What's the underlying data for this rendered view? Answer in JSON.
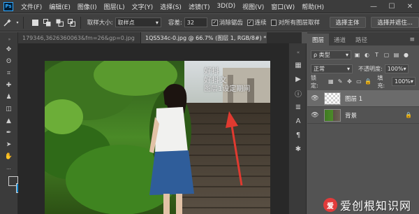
{
  "app": {
    "logo": "Ps"
  },
  "menu": [
    "文件(F)",
    "编辑(E)",
    "图像(I)",
    "图层(L)",
    "文字(Y)",
    "选择(S)",
    "滤镜(T)",
    "3D(D)",
    "视图(V)",
    "窗口(W)",
    "帮助(H)"
  ],
  "window_controls": {
    "minimize": "—",
    "maximize": "☐",
    "close": "✕"
  },
  "options_bar": {
    "sample_size_label": "取样大小:",
    "sample_size_value": "取样点",
    "tolerance_label": "容差:",
    "tolerance_value": "32",
    "antialias_label": "消除锯齿",
    "antialias_checked": true,
    "contiguous_label": "连续",
    "contiguous_checked": true,
    "all_layers_label": "对所有图层取样",
    "all_layers_checked": false,
    "select_subject_label": "选择主体",
    "select_and_mask_label": "选择并遮住..."
  },
  "doc_tabs": [
    {
      "label": "179346,3626360063&fm=26&gp=0.jpg",
      "active": false
    },
    {
      "label": "1QS534c-0.jpg @ 66.7% (图层 1, RGB/8#) *",
      "active": true
    }
  ],
  "panel_tabs": [
    "图层",
    "通道",
    "路径"
  ],
  "layers_panel": {
    "filter_label": "ρ 类型",
    "blend_mode": "正常",
    "opacity_label": "不透明度:",
    "opacity_value": "100%",
    "lock_label": "锁定:",
    "fill_label": "填充:",
    "fill_value": "100%",
    "layers": [
      {
        "name": "图层 1",
        "selected": true,
        "locked": false
      },
      {
        "name": "背景",
        "selected": false,
        "locked": true
      }
    ]
  },
  "canvas_overlay": {
    "lines": [
      "好抖",
      "好抖文",
      "图层1设定期间"
    ]
  },
  "watermark": {
    "logo_char": "爱",
    "text": "爱创根知识网"
  },
  "colors": {
    "accent": "#31a8ff",
    "background_swatch": "#1e92d8",
    "foreground_swatch": "#3a3a3a",
    "arrow": "#e03a30"
  }
}
